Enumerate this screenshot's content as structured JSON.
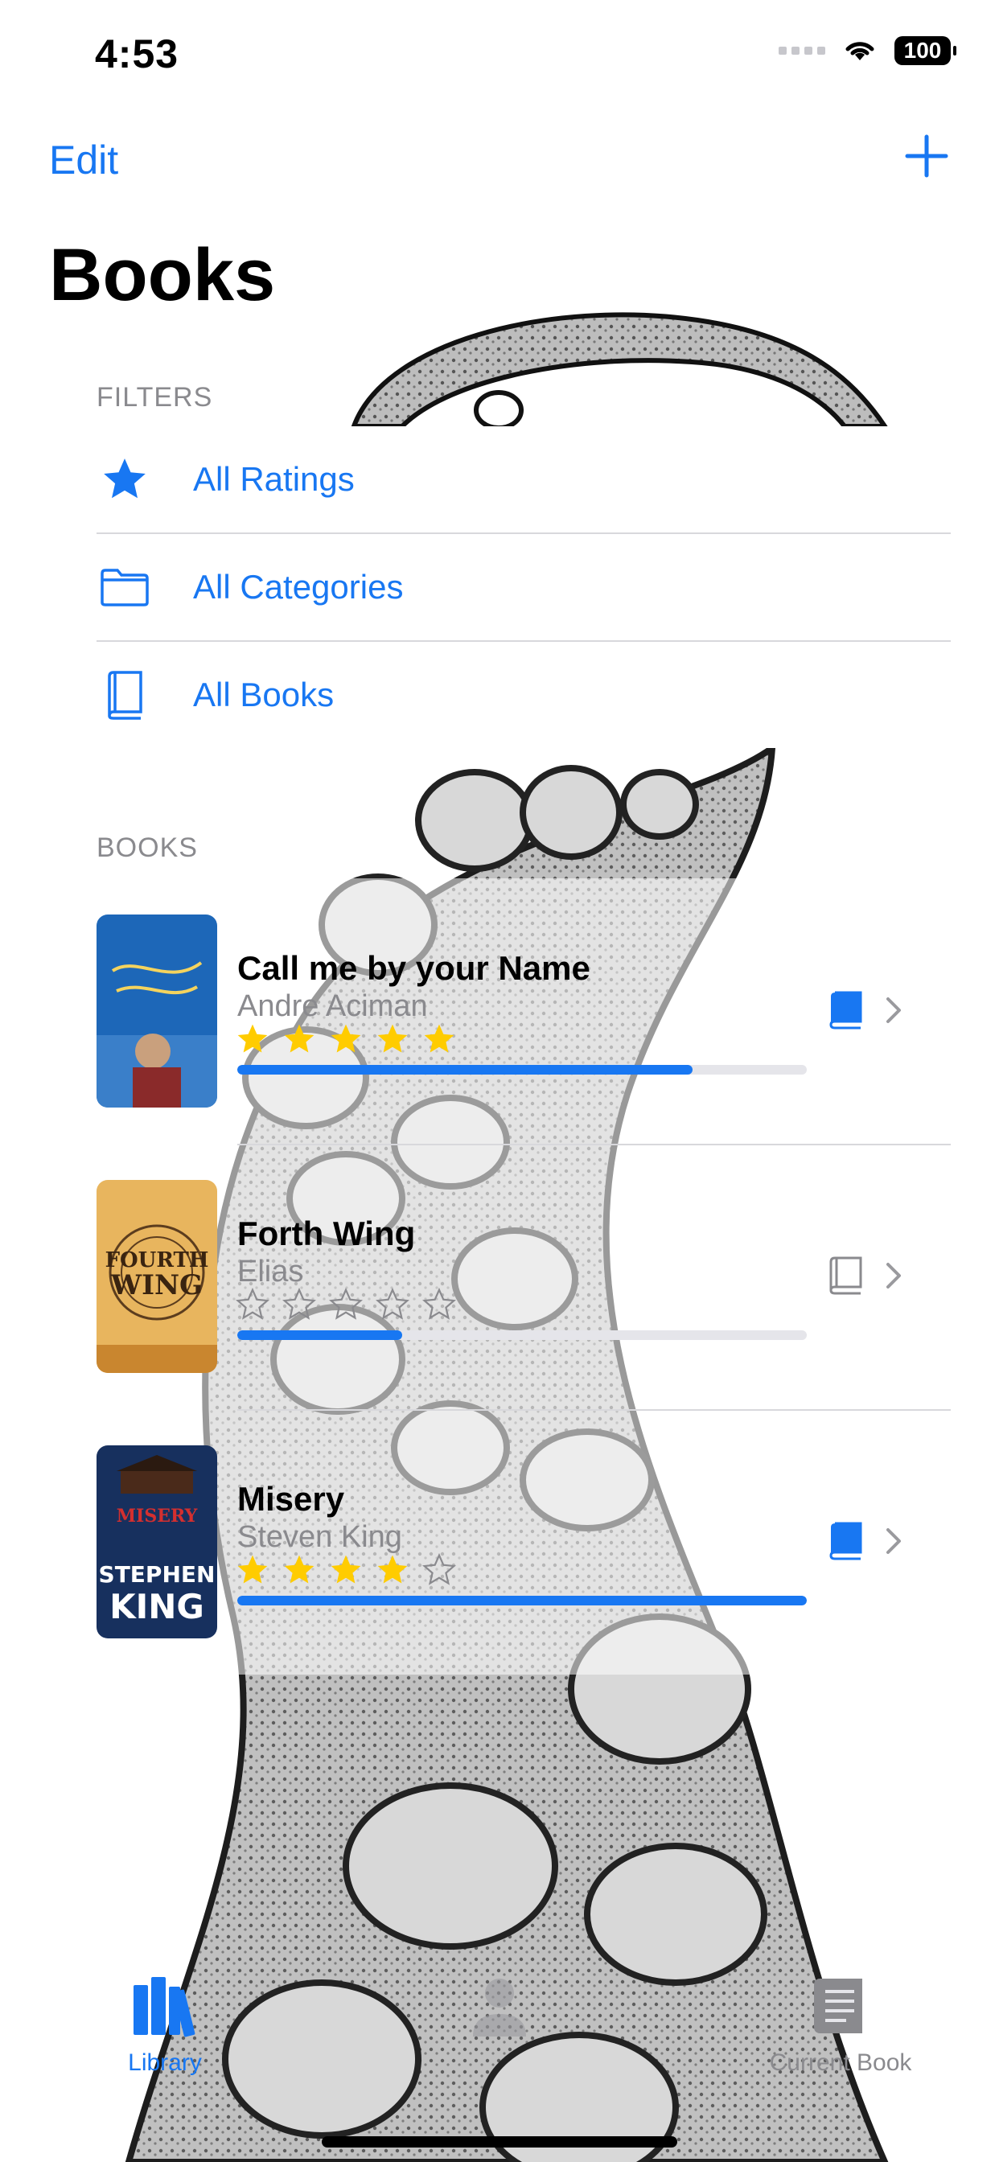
{
  "status_bar": {
    "time": "4:53",
    "battery": "100"
  },
  "nav": {
    "edit_label": "Edit",
    "add_icon": "plus-icon",
    "title": "Books"
  },
  "filters": {
    "header": "FILTERS",
    "items": [
      {
        "label": "All Ratings",
        "icon": "star-icon"
      },
      {
        "label": "All Categories",
        "icon": "folder-icon"
      },
      {
        "label": "All Books",
        "icon": "book-icon"
      }
    ]
  },
  "books": {
    "header": "BOOKS",
    "items": [
      {
        "title": "Call me by your Name",
        "author": "Andre Aciman",
        "rating": 5,
        "progress": 0.8,
        "reading": true
      },
      {
        "title": "Forth Wing",
        "author": "Elias",
        "rating": 0,
        "progress": 0.29,
        "reading": false
      },
      {
        "title": "Misery",
        "author": "Steven King",
        "rating": 4,
        "progress": 1.0,
        "reading": true
      }
    ]
  },
  "colors": {
    "accent": "#1877f2",
    "star": "#ffcc00",
    "muted": "#8a8a8e"
  },
  "tabs": [
    {
      "label": "Library",
      "icon": "library-icon",
      "active": true
    },
    {
      "label": "",
      "icon": "person-icon",
      "active": false
    },
    {
      "label": "Current Book",
      "icon": "current-book-icon",
      "active": false
    }
  ]
}
